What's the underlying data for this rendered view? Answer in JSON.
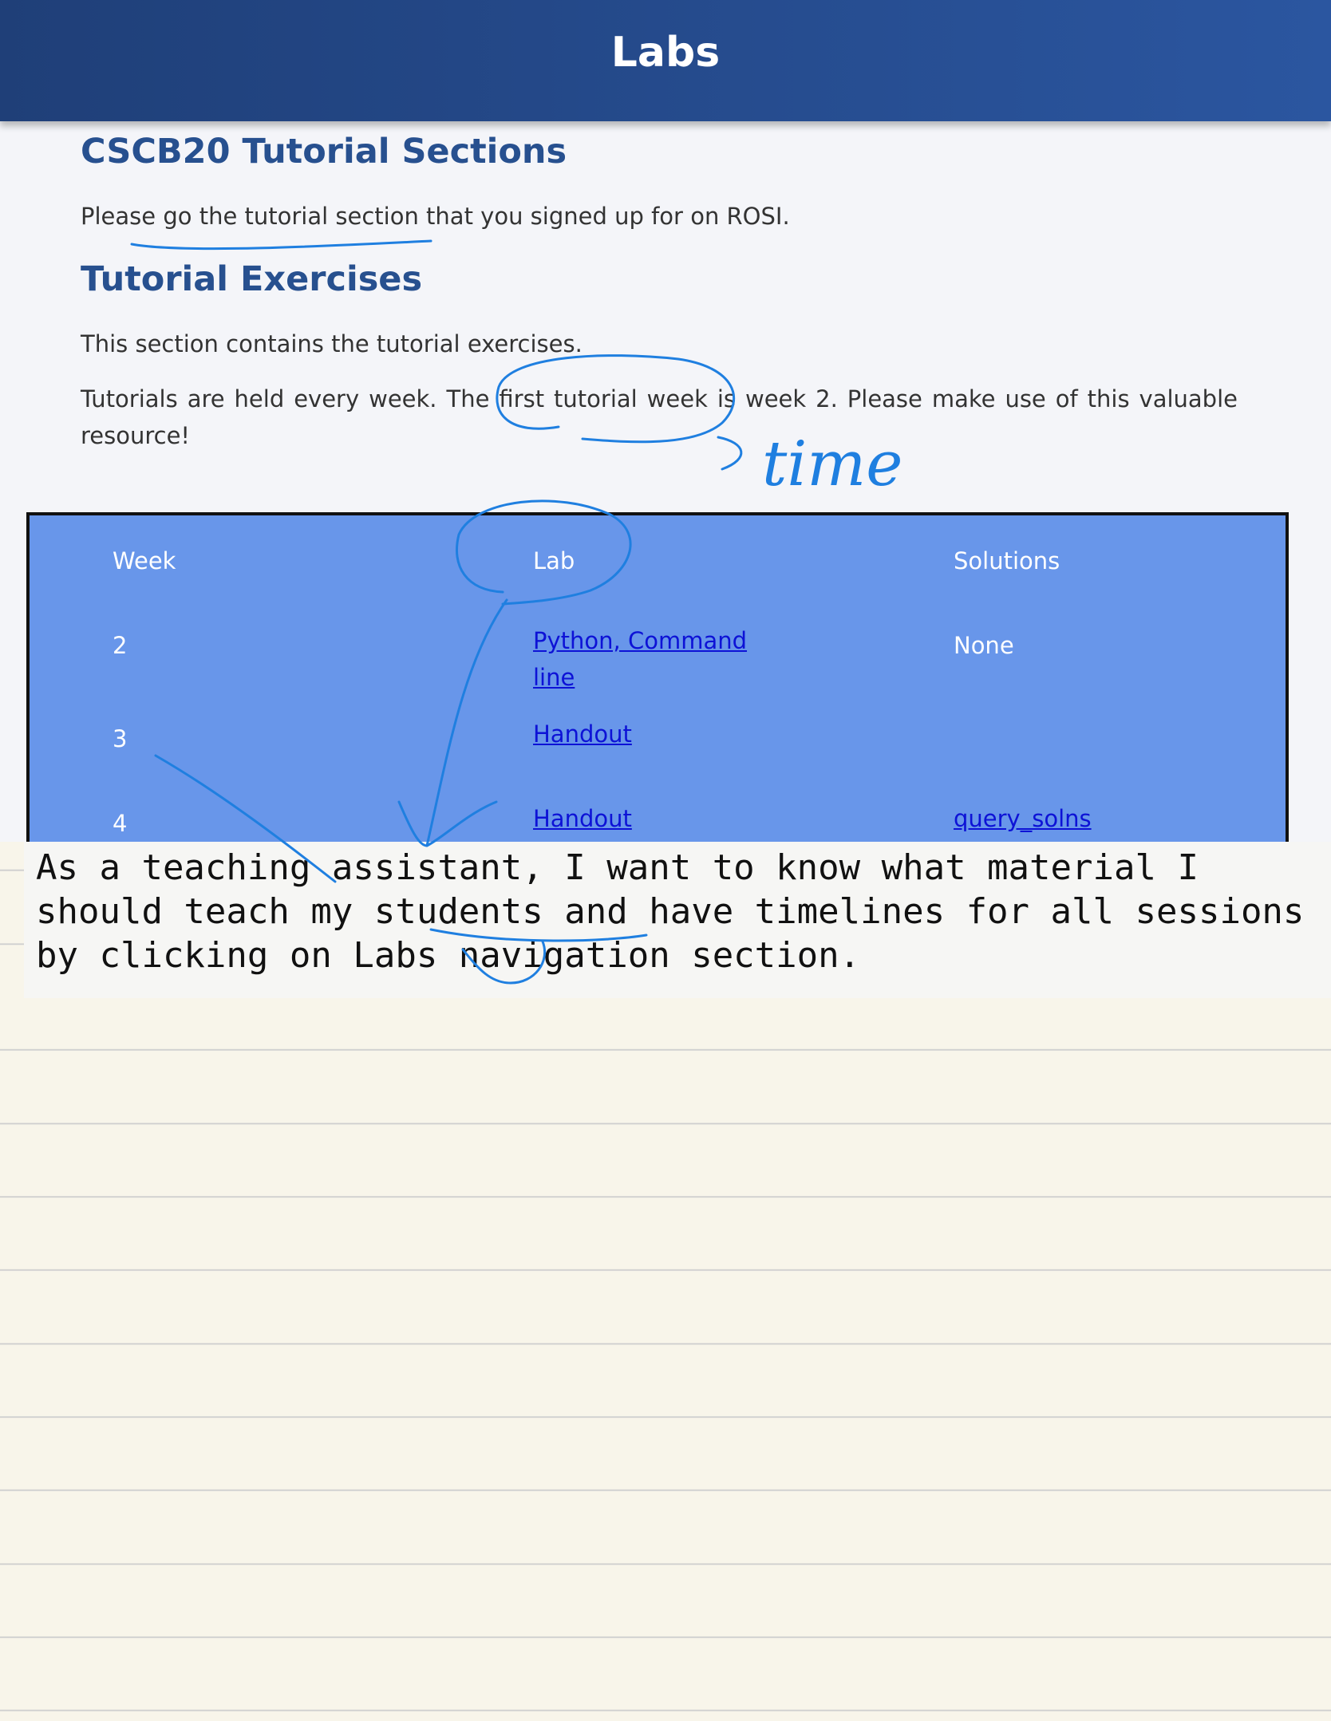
{
  "header": {
    "title": "Labs"
  },
  "sections": {
    "tutorial_sections_heading": "CSCB20 Tutorial Sections",
    "tutorial_sections_text": "Please go the tutorial section that you signed up for on ROSI.",
    "tutorial_exercises_heading": "Tutorial Exercises",
    "tutorial_exercises_text": "This section contains the tutorial exercises.",
    "tutorial_schedule_text": "Tutorials are held every week. The first tutorial week is week 2. Please make use of this valuable resource!"
  },
  "table": {
    "headers": [
      "Week",
      "Lab",
      "Solutions"
    ],
    "rows": [
      {
        "week": "2",
        "lab": "Python, Command line",
        "solutions": "None"
      },
      {
        "week": "3",
        "lab": "Handout",
        "solutions": ""
      },
      {
        "week": "4",
        "lab": "Handout",
        "solutions": "query_solns"
      }
    ]
  },
  "note": {
    "text": "As a teaching assistant, I want to know what material I should teach my students and have timelines for all sessions by clicking on Labs navigation section."
  },
  "annotations": {
    "handwritten": "time",
    "ink_color": "#1f7fe0"
  }
}
